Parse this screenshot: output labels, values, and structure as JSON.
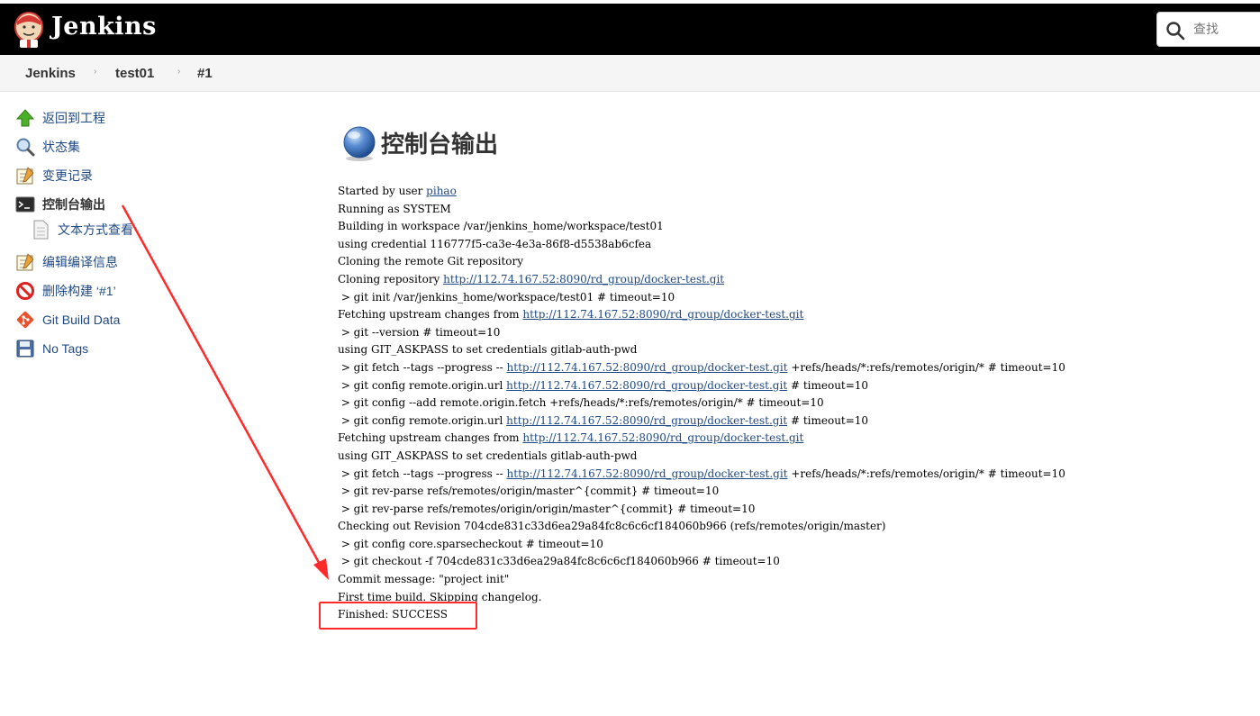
{
  "header": {
    "brand": "Jenkins",
    "search_placeholder": "查找"
  },
  "breadcrumb": [
    "Jenkins",
    "test01",
    "#1"
  ],
  "sidebar": {
    "items": [
      {
        "label": "返回到工程",
        "icon": "up-arrow-icon"
      },
      {
        "label": "状态集",
        "icon": "magnifier-icon"
      },
      {
        "label": "变更记录",
        "icon": "notepad-icon"
      },
      {
        "label": "控制台输出",
        "icon": "terminal-icon",
        "active": true
      },
      {
        "label": "文本方式查看",
        "icon": "document-icon",
        "sub": true
      },
      {
        "label": "编辑编译信息",
        "icon": "notepad-icon"
      },
      {
        "label": "删除构建 ‘#1’",
        "icon": "no-entry-icon"
      },
      {
        "label": "Git Build Data",
        "icon": "git-icon"
      },
      {
        "label": "No Tags",
        "icon": "floppy-disk-icon"
      }
    ]
  },
  "main": {
    "title": "控制台输出",
    "console_lines": [
      [
        {
          "t": "Started by user "
        },
        {
          "t": "pihao",
          "link": true
        }
      ],
      [
        {
          "t": "Running as SYSTEM"
        }
      ],
      [
        {
          "t": "Building in workspace /var/jenkins_home/workspace/test01"
        }
      ],
      [
        {
          "t": "using credential 116777f5-ca3e-4e3a-86f8-d5538ab6cfea"
        }
      ],
      [
        {
          "t": "Cloning the remote Git repository"
        }
      ],
      [
        {
          "t": "Cloning repository "
        },
        {
          "t": "http://112.74.167.52:8090/rd_group/docker-test.git",
          "link": true
        }
      ],
      [
        {
          "t": " > git init /var/jenkins_home/workspace/test01 # timeout=10"
        }
      ],
      [
        {
          "t": "Fetching upstream changes from "
        },
        {
          "t": "http://112.74.167.52:8090/rd_group/docker-test.git",
          "link": true
        }
      ],
      [
        {
          "t": " > git --version # timeout=10"
        }
      ],
      [
        {
          "t": "using GIT_ASKPASS to set credentials gitlab-auth-pwd"
        }
      ],
      [
        {
          "t": " > git fetch --tags --progress -- "
        },
        {
          "t": "http://112.74.167.52:8090/rd_group/docker-test.git",
          "link": true
        },
        {
          "t": " +refs/heads/*:refs/remotes/origin/* # timeout=10"
        }
      ],
      [
        {
          "t": " > git config remote.origin.url "
        },
        {
          "t": "http://112.74.167.52:8090/rd_group/docker-test.git",
          "link": true
        },
        {
          "t": " # timeout=10"
        }
      ],
      [
        {
          "t": " > git config --add remote.origin.fetch +refs/heads/*:refs/remotes/origin/* # timeout=10"
        }
      ],
      [
        {
          "t": " > git config remote.origin.url "
        },
        {
          "t": "http://112.74.167.52:8090/rd_group/docker-test.git",
          "link": true
        },
        {
          "t": " # timeout=10"
        }
      ],
      [
        {
          "t": "Fetching upstream changes from "
        },
        {
          "t": "http://112.74.167.52:8090/rd_group/docker-test.git",
          "link": true
        }
      ],
      [
        {
          "t": "using GIT_ASKPASS to set credentials gitlab-auth-pwd"
        }
      ],
      [
        {
          "t": " > git fetch --tags --progress -- "
        },
        {
          "t": "http://112.74.167.52:8090/rd_group/docker-test.git",
          "link": true
        },
        {
          "t": " +refs/heads/*:refs/remotes/origin/* # timeout=10"
        }
      ],
      [
        {
          "t": " > git rev-parse refs/remotes/origin/master^{commit} # timeout=10"
        }
      ],
      [
        {
          "t": " > git rev-parse refs/remotes/origin/origin/master^{commit} # timeout=10"
        }
      ],
      [
        {
          "t": "Checking out Revision 704cde831c33d6ea29a84fc8c6c6cf184060b966 (refs/remotes/origin/master)"
        }
      ],
      [
        {
          "t": " > git config core.sparsecheckout # timeout=10"
        }
      ],
      [
        {
          "t": " > git checkout -f 704cde831c33d6ea29a84fc8c6c6cf184060b966 # timeout=10"
        }
      ],
      [
        {
          "t": "Commit message: \"project init\""
        }
      ],
      [
        {
          "t": "First time build. Skipping changelog."
        }
      ],
      [
        {
          "t": "Finished: SUCCESS"
        }
      ]
    ]
  },
  "colors": {
    "header_bg": "#000000",
    "link": "#204a87",
    "annotation": "#ff2a2a"
  }
}
